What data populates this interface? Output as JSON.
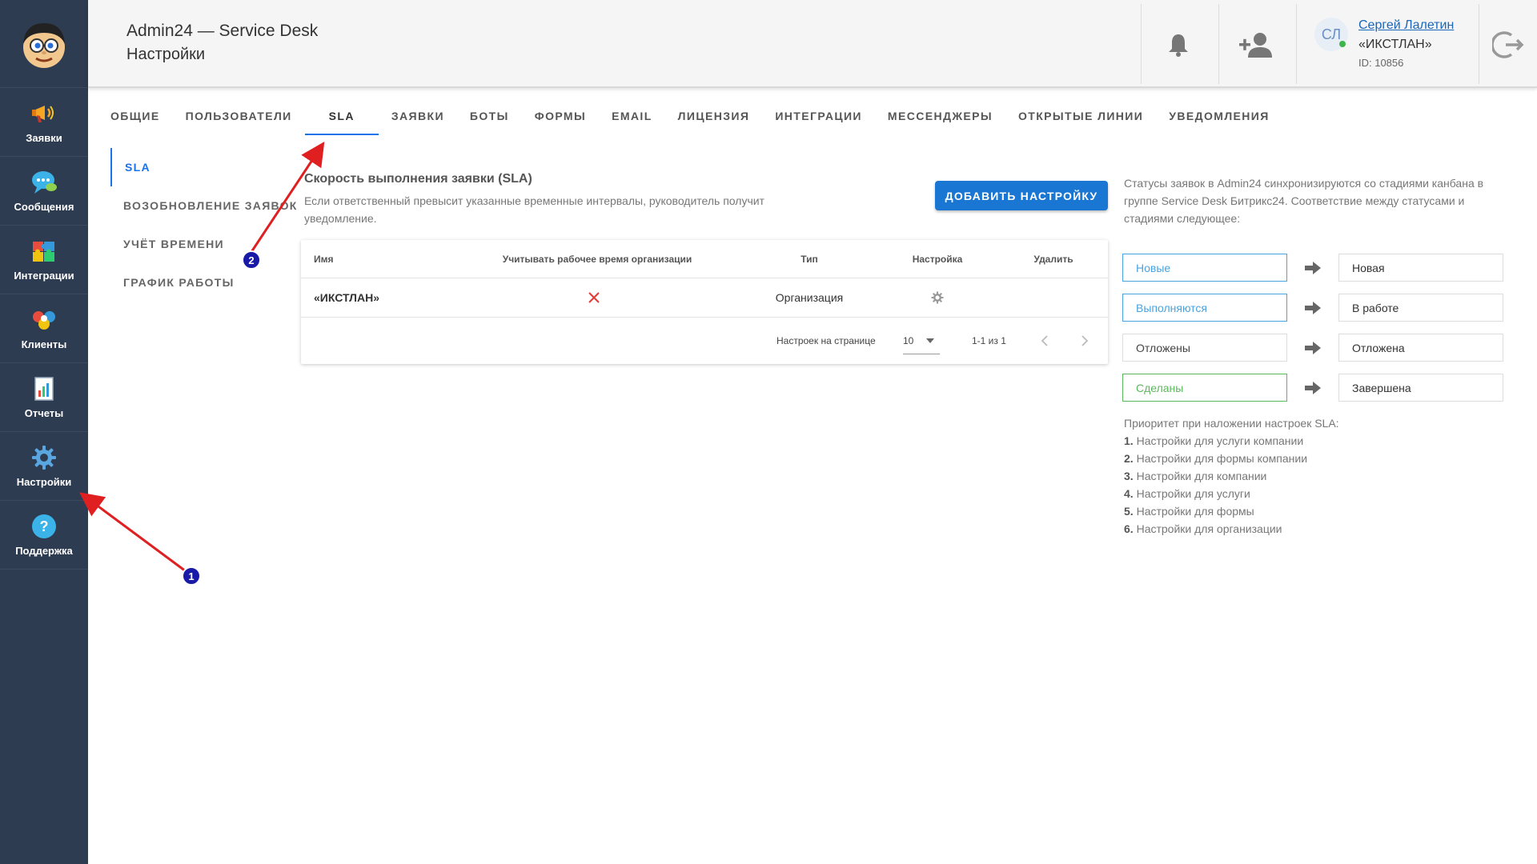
{
  "sidebar": {
    "items": [
      {
        "label": "Заявки",
        "icon": "megaphone-icon"
      },
      {
        "label": "Сообщения",
        "icon": "chat-bubble-icon"
      },
      {
        "label": "Интеграции",
        "icon": "puzzle-icon"
      },
      {
        "label": "Клиенты",
        "icon": "clients-icon"
      },
      {
        "label": "Отчеты",
        "icon": "report-icon"
      },
      {
        "label": "Настройки",
        "icon": "gear-icon"
      },
      {
        "label": "Поддержка",
        "icon": "help-icon"
      }
    ]
  },
  "header": {
    "app_title": "Admin24 — Service Desk",
    "page_title": "Настройки",
    "user": {
      "initials": "СЛ",
      "name": "Сергей Лалетин",
      "company": "«ИКСТЛАН»",
      "id_text": "ID: 10856"
    }
  },
  "tabs": [
    "ОБЩИЕ",
    "ПОЛЬЗОВАТЕЛИ",
    "SLA",
    "ЗАЯВКИ",
    "БОТЫ",
    "ФОРМЫ",
    "EMAIL",
    "ЛИЦЕНЗИЯ",
    "ИНТЕГРАЦИИ",
    "МЕССЕНДЖЕРЫ",
    "ОТКРЫТЫЕ ЛИНИИ",
    "УВЕДОМЛЕНИЯ"
  ],
  "active_tab": "SLA",
  "subnav": [
    "SLA",
    "ВОЗОБНОВЛЕНИЕ ЗАЯВОК",
    "УЧЁТ ВРЕМЕНИ",
    "ГРАФИК РАБОТЫ"
  ],
  "sla": {
    "title": "Скорость выполнения заявки (SLA)",
    "description": "Если ответственный превысит указанные временные интервалы, руководитель получит уведомление.",
    "add_button": "ДОБАВИТЬ НАСТРОЙКУ"
  },
  "table": {
    "headers": {
      "name": "Имя",
      "work_time": "Учитывать рабочее время организации",
      "type": "Тип",
      "settings": "Настройка",
      "delete": "Удалить"
    },
    "rows": [
      {
        "name": "«ИКСТЛАН»",
        "work_time": false,
        "type": "Организация"
      }
    ],
    "footer": {
      "per_page_label": "Настроек на странице",
      "per_page_value": "10",
      "range": "1-1 из 1"
    }
  },
  "right_panel": {
    "info": "Статусы заявок в Admin24 синхронизируются со стадиями канбана в группе Service Desk Битрикс24. Соответствие между статусами и стадиями следующее:",
    "mappings": [
      {
        "status": "Новые",
        "stage": "Новая",
        "color": "#4aa3df"
      },
      {
        "status": "Выполняются",
        "stage": "В работе",
        "color": "#4aa3df"
      },
      {
        "status": "Отложены",
        "stage": "Отложена",
        "color": "#444444"
      },
      {
        "status": "Сделаны",
        "stage": "Завершена",
        "color": "#5cb85c"
      }
    ],
    "priority_title": "Приоритет при наложении настроек SLA:",
    "priority_items": [
      {
        "num": "1.",
        "text": "Настройки для услуги компании"
      },
      {
        "num": "2.",
        "text": "Настройки для формы компании"
      },
      {
        "num": "3.",
        "text": "Настройки для компании"
      },
      {
        "num": "4.",
        "text": "Настройки для услуги"
      },
      {
        "num": "5.",
        "text": "Настройки для формы"
      },
      {
        "num": "6.",
        "text": "Настройки для организации"
      }
    ]
  },
  "annotations": [
    {
      "num": "1",
      "color": "#1a1aa8"
    },
    {
      "num": "2",
      "color": "#1a1aa8"
    }
  ],
  "colors": {
    "sidebar_bg": "#2e3c51",
    "accent": "#1976d2",
    "annotation_arrow": "#e02020"
  }
}
